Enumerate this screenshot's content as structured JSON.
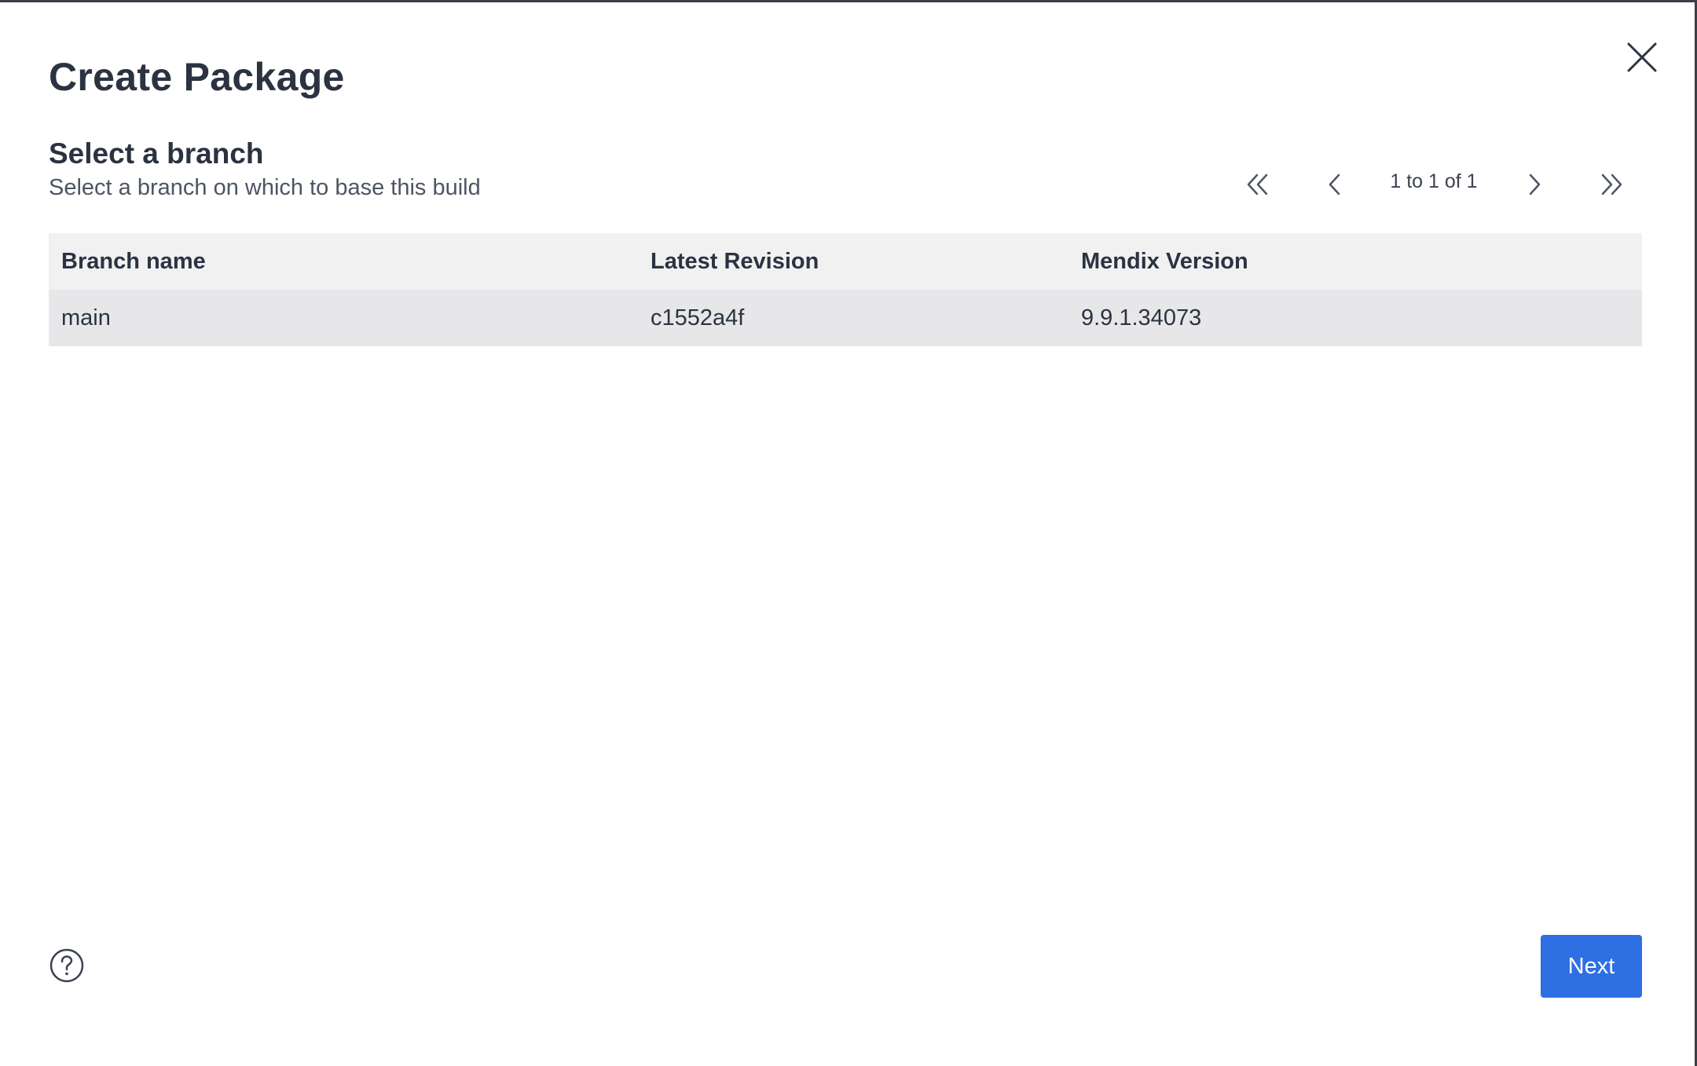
{
  "dialog": {
    "title": "Create Package",
    "section_title": "Select a branch",
    "section_subtitle": "Select a branch on which to base this build"
  },
  "pager": {
    "status": "1 to 1 of 1",
    "first_icon": "chevrons-left-icon",
    "prev_icon": "chevron-left-icon",
    "next_icon": "chevron-right-icon",
    "last_icon": "chevrons-right-icon"
  },
  "table": {
    "columns": [
      "Branch name",
      "Latest Revision",
      "Mendix Version"
    ],
    "rows": [
      [
        "main",
        "c1552a4f",
        "9.9.1.34073"
      ]
    ]
  },
  "footer": {
    "help_icon": "help-circle-icon",
    "next_label": "Next"
  },
  "colors": {
    "primary": "#2f6fe4",
    "header_bg": "#f1f1f2",
    "row_bg": "#e7e7e9",
    "text": "#2b3341"
  }
}
